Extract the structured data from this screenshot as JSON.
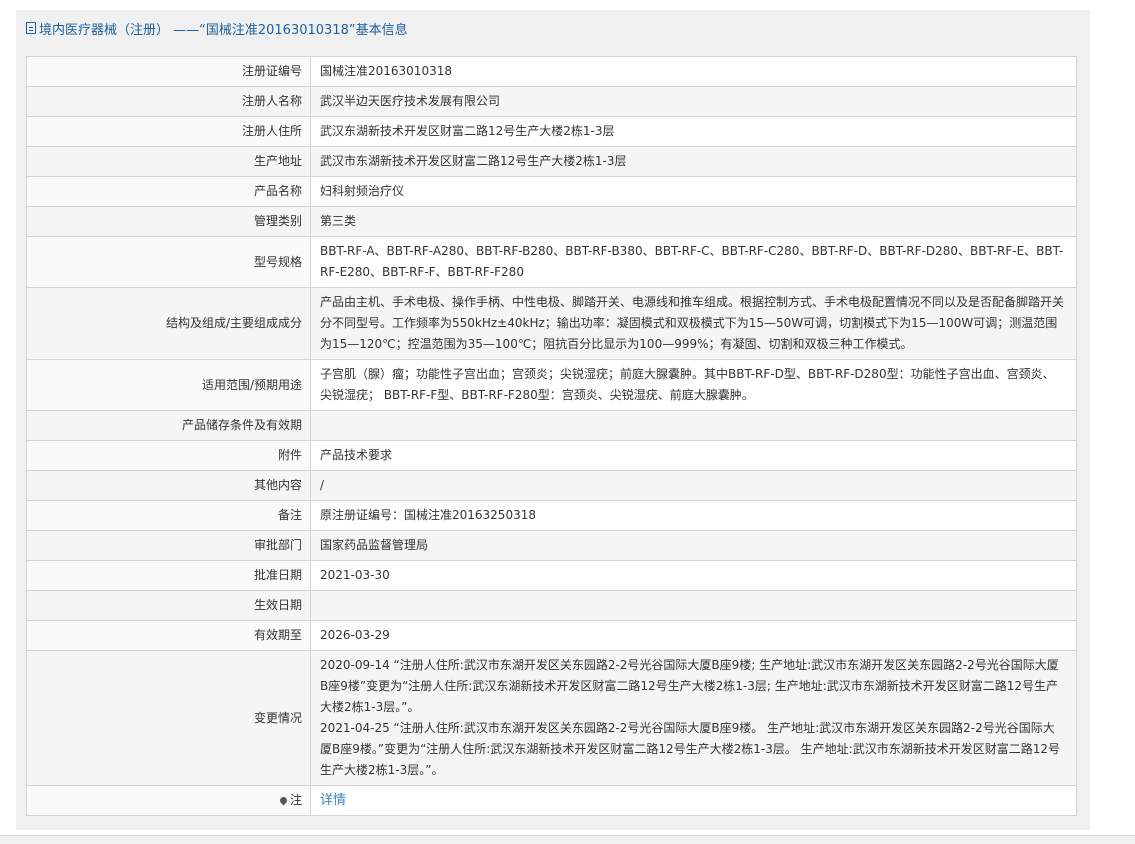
{
  "header": {
    "title": "境内医疗器械（注册）  ——“国械注准20163010318”基本信息"
  },
  "rows": [
    {
      "label": "注册证编号",
      "value": "国械注准20163010318"
    },
    {
      "label": "注册人名称",
      "value": "武汉半边天医疗技术发展有限公司"
    },
    {
      "label": "注册人住所",
      "value": "武汉东湖新技术开发区财富二路12号生产大楼2栋1-3层"
    },
    {
      "label": "生产地址",
      "value": "武汉市东湖新技术开发区财富二路12号生产大楼2栋1-3层"
    },
    {
      "label": "产品名称",
      "value": "妇科射频治疗仪"
    },
    {
      "label": "管理类别",
      "value": "第三类"
    },
    {
      "label": "型号规格",
      "value": "BBT-RF-A、BBT-RF-A280、BBT-RF-B280、BBT-RF-B380、BBT-RF-C、BBT-RF-C280、BBT-RF-D、BBT-RF-D280、BBT-RF-E、BBT-RF-E280、BBT-RF-F、BBT-RF-F280"
    },
    {
      "label": "结构及组成/主要组成成分",
      "value": "产品由主机、手术电极、操作手柄、中性电极、脚踏开关、电源线和推车组成。根据控制方式、手术电极配置情况不同以及是否配备脚踏开关分不同型号。工作频率为550kHz±40kHz；输出功率：凝固模式和双极模式下为15—50W可调，切割模式下为15—100W可调；测温范围为15—120℃；控温范围为35—100℃；阻抗百分比显示为100—999%；有凝固、切割和双极三种工作模式。"
    },
    {
      "label": "适用范围/预期用途",
      "value": "子宫肌（腺）瘤；功能性子宫出血；宫颈炎；尖锐湿疣；前庭大腺囊肿。其中BBT-RF-D型、BBT-RF-D280型：功能性子宫出血、宫颈炎、尖锐湿疣； BBT-RF-F型、BBT-RF-F280型：宫颈炎、尖锐湿疣、前庭大腺囊肿。"
    },
    {
      "label": "产品储存条件及有效期",
      "value": ""
    },
    {
      "label": "附件",
      "value": "产品技术要求"
    },
    {
      "label": "其他内容",
      "value": "/"
    },
    {
      "label": "备注",
      "value": "原注册证编号：国械注准20163250318"
    },
    {
      "label": "审批部门",
      "value": "国家药品监督管理局"
    },
    {
      "label": "批准日期",
      "value": "2021-03-30"
    },
    {
      "label": "生效日期",
      "value": ""
    },
    {
      "label": "有效期至",
      "value": "2026-03-29"
    }
  ],
  "changes": {
    "label": "变更情况",
    "entries": [
      "2020-09-14 “注册人住所:武汉市东湖开发区关东园路2-2号光谷国际大厦B座9楼; 生产地址:武汉市东湖开发区关东园路2-2号光谷国际大厦B座9楼”变更为“注册人住所:武汉东湖新技术开发区财富二路12号生产大楼2栋1-3层; 生产地址:武汉市东湖新技术开发区财富二路12号生产大楼2栋1-3层。”。",
      "2021-04-25 “注册人住所:武汉市东湖开发区关东园路2-2号光谷国际大厦B座9楼。 生产地址:武汉市东湖开发区关东园路2-2号光谷国际大厦B座9楼。”变更为“注册人住所:武汉东湖新技术开发区财富二路12号生产大楼2栋1-3层。 生产地址:武汉市东湖新技术开发区财富二路12号生产大楼2栋1-3层。”。"
    ]
  },
  "note": {
    "label": "注",
    "link_text": "详情"
  },
  "colors": {
    "header_text": "#1a5f9e",
    "link": "#3a7fc4",
    "panel_bg": "#f0f0f0",
    "row_alt_bg": "#f5f5f5",
    "border": "#d4d4d4"
  },
  "icons": [
    "document-icon",
    "map-pin-icon"
  ]
}
